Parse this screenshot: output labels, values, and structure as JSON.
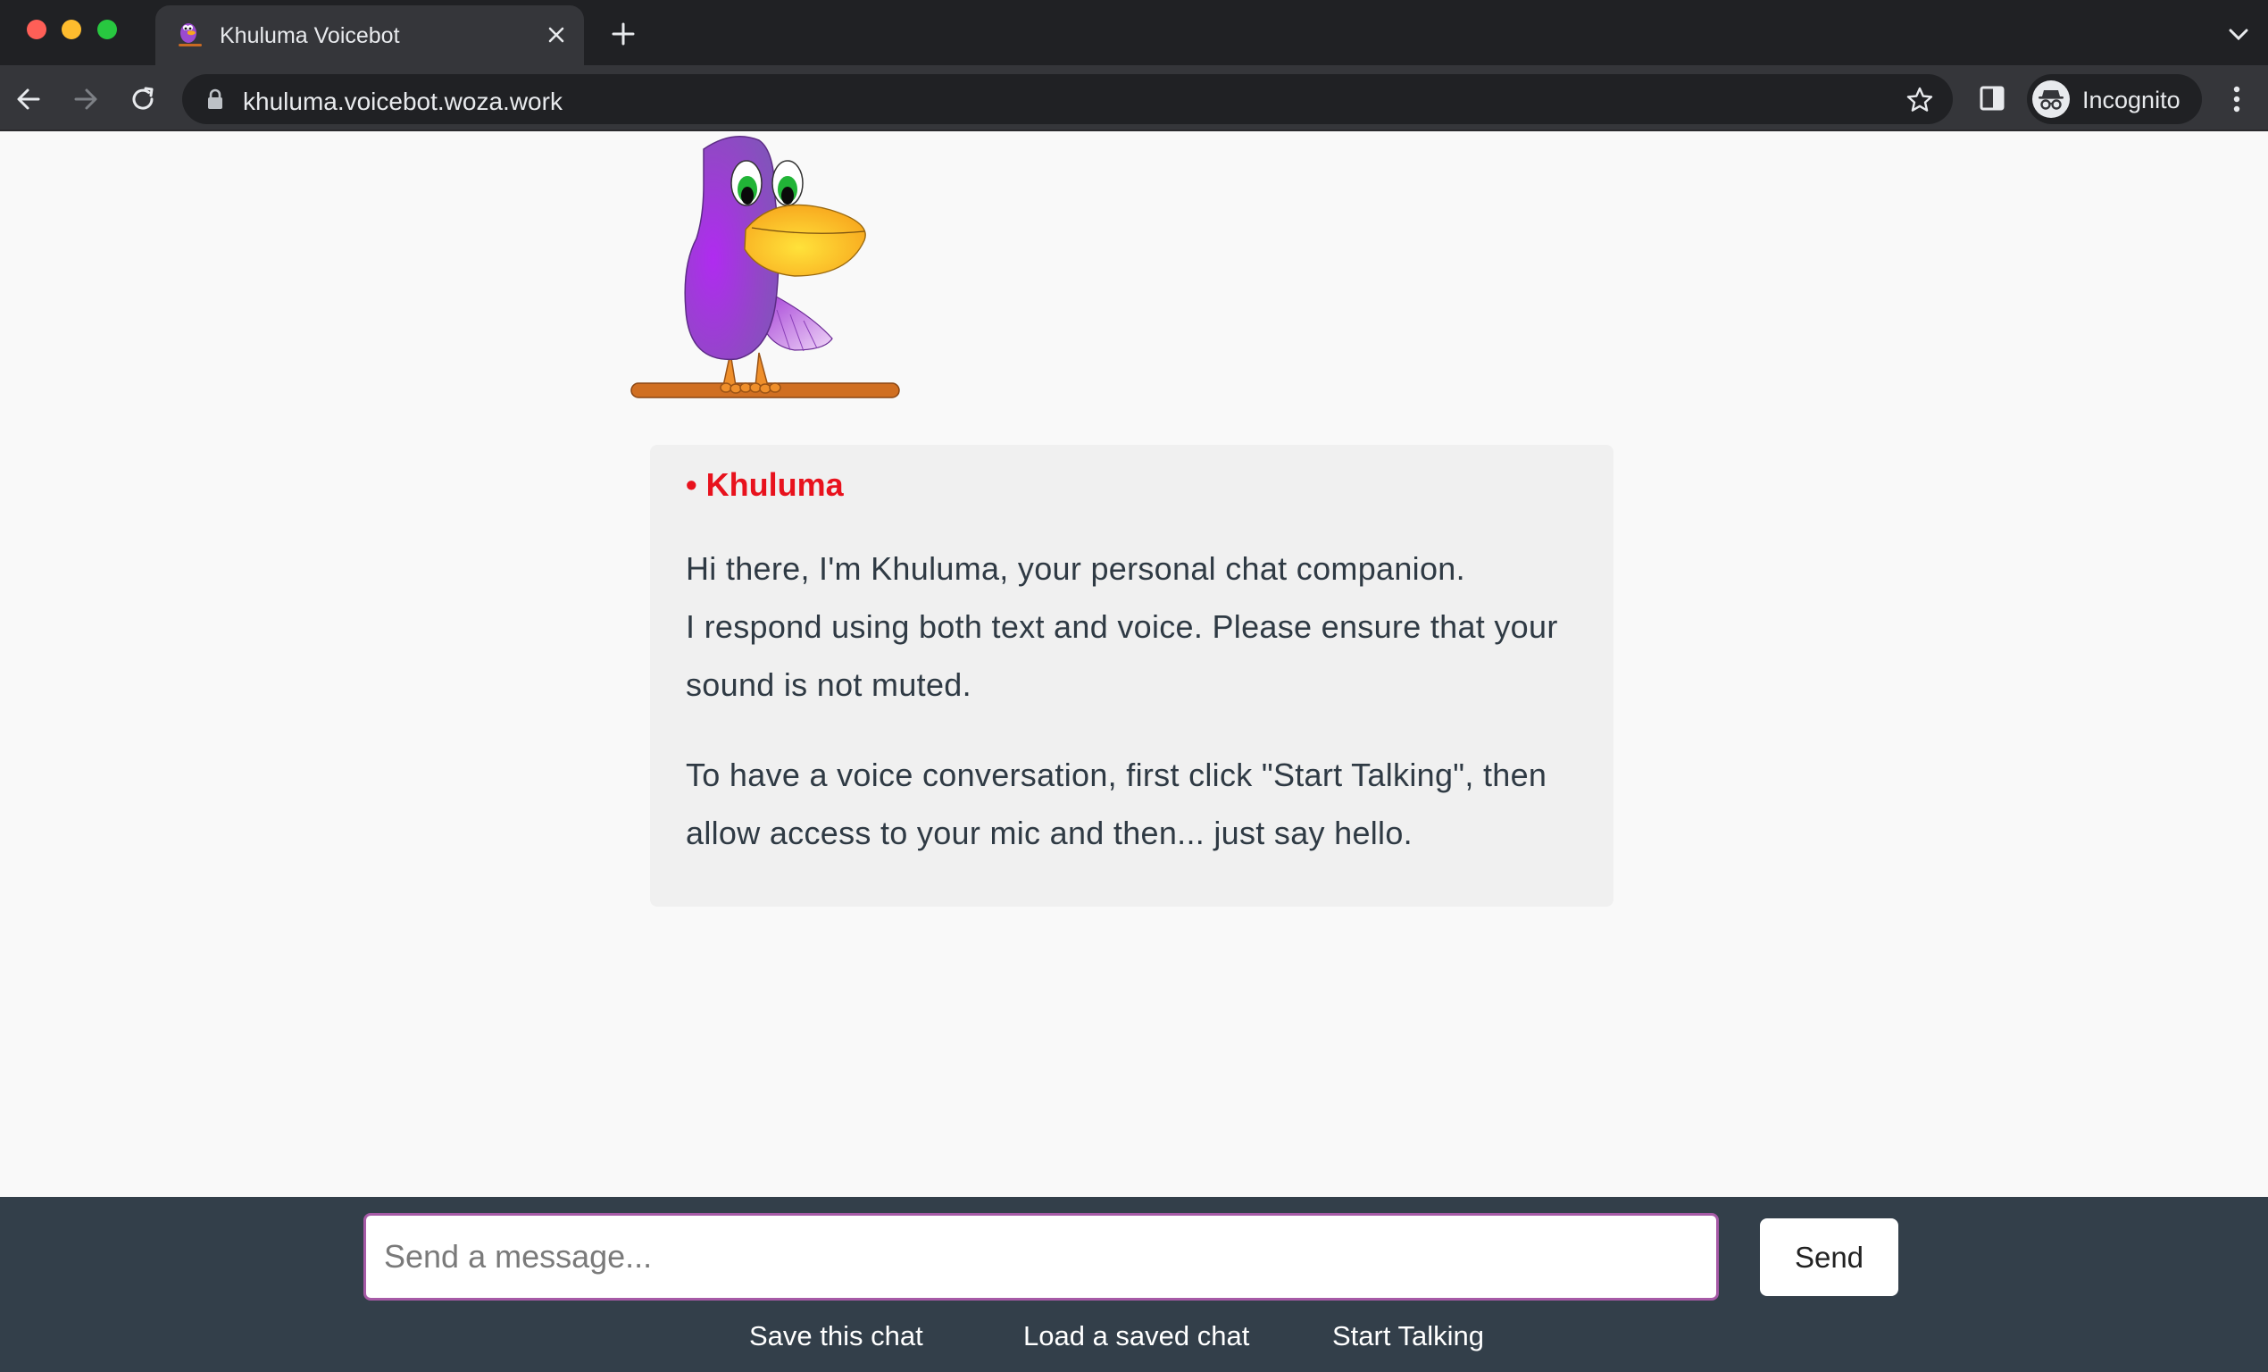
{
  "browser": {
    "tab_title": "Khuluma Voicebot",
    "url": "khuluma.voicebot.woza.work",
    "profile_label": "Incognito",
    "icons": [
      "back-icon",
      "forward-icon",
      "reload-icon",
      "lock-icon",
      "star-icon",
      "side-panel-icon",
      "incognito-icon",
      "more-menu-icon",
      "close-icon",
      "plus-icon",
      "chevron-down-icon"
    ]
  },
  "chat": {
    "sender": "• Khuluma",
    "sender_color": "#e8121d",
    "paragraph1_line1": "Hi there, I'm Khuluma, your personal chat companion.",
    "paragraph1_line2": "I respond using both text and voice. Please ensure that your sound is not muted.",
    "paragraph2": "To have a voice conversation, first click \"Start Talking\", then allow access to your mic and then... just say hello."
  },
  "footer": {
    "input_placeholder": "Send a message...",
    "send_label": "Send",
    "save_label": "Save this chat",
    "load_label": "Load a saved chat",
    "talk_label": "Start Talking",
    "background_color": "#333f4a",
    "input_border_color": "#a65aa6"
  }
}
